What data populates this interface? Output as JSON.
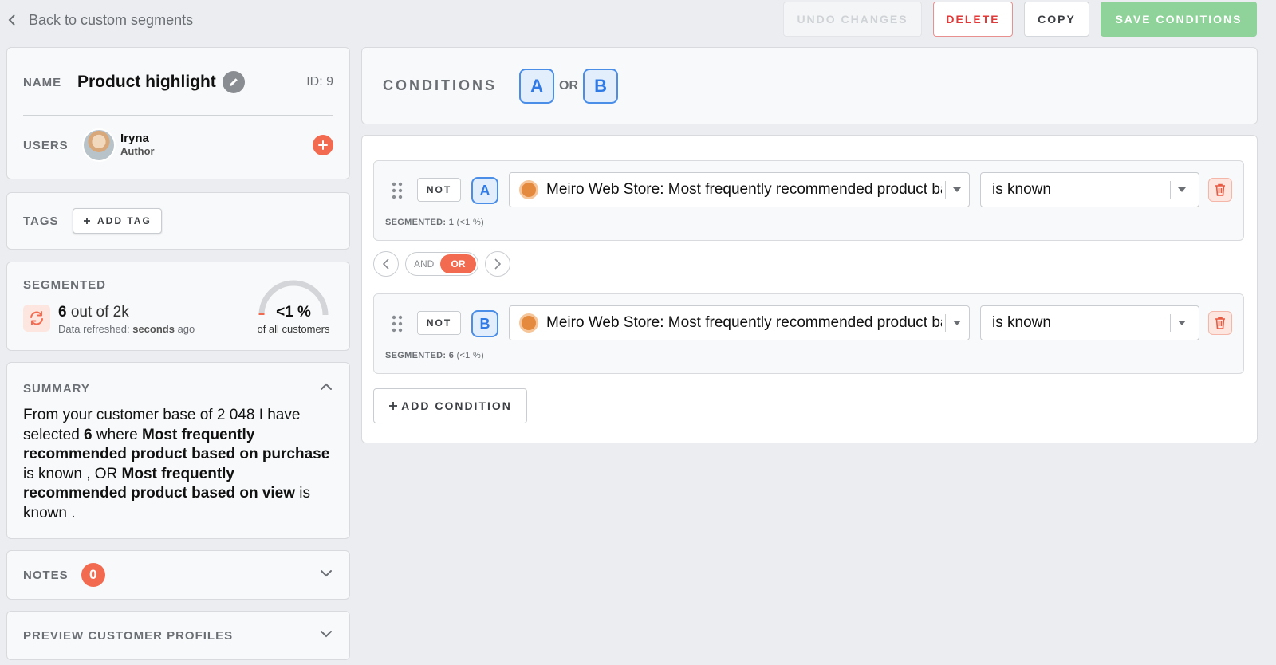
{
  "nav": {
    "back_label": "Back to custom segments"
  },
  "actions": {
    "undo": "UNDO CHANGES",
    "delete": "DELETE",
    "copy": "COPY",
    "save": "SAVE CONDITIONS"
  },
  "segment": {
    "name_label": "NAME",
    "name": "Product highlight",
    "id": "ID: 9",
    "users_label": "USERS",
    "user": {
      "name": "Iryna",
      "role": "Author"
    },
    "tags_label": "TAGS",
    "add_tag": "ADD TAG"
  },
  "segmented": {
    "label": "SEGMENTED",
    "count": "6",
    "out_of": " out of 2k",
    "refresh_prefix": "Data refreshed: ",
    "refresh_time": "seconds",
    "refresh_suffix": " ago",
    "percent": "<1 %",
    "percent_sub": "of all customers",
    "gauge_fraction": 0.003
  },
  "summary": {
    "label": "SUMMARY",
    "p1": "From your customer base of 2 048 I have selected ",
    "count": "6",
    "p2": " where ",
    "attr1": "Most frequently recommended product based on purchase",
    "p3": " is known , OR ",
    "attr2": "Most frequently recommended product based on view",
    "p4": " is known ."
  },
  "notes": {
    "label": "NOTES",
    "count": "0"
  },
  "preview": {
    "label": "PREVIEW CUSTOMER PROFILES"
  },
  "conditions": {
    "title": "CONDITIONS",
    "expr_a": "A",
    "expr_or": "OR",
    "expr_b": "B",
    "rows": [
      {
        "not": "NOT",
        "letter": "A",
        "attribute": "Meiro Web Store: Most frequently recommended product based on purchase",
        "operator": "is known",
        "seg_label": "SEGMENTED: 1",
        "seg_pct": "(<1 %)"
      },
      {
        "not": "NOT",
        "letter": "B",
        "attribute": "Meiro Web Store: Most frequently recommended product based on view",
        "operator": "is known",
        "seg_label": "SEGMENTED: 6",
        "seg_pct": "(<1 %)"
      }
    ],
    "toggle_and": "AND",
    "toggle_or": "OR",
    "add_condition": "ADD CONDITION"
  },
  "colors": {
    "accent_orange": "#f26b50",
    "accent_blue": "#2f7ae5",
    "save_green": "#8fd29a",
    "delete_red": "#e03a3a"
  },
  "icons": [
    "chevron-left-icon",
    "pencil-icon",
    "plus-icon",
    "refresh-icon",
    "chevron-up-icon",
    "chevron-down-icon",
    "drag-handle-icon",
    "caret-down-icon",
    "trash-icon",
    "arrow-left-icon",
    "arrow-right-icon",
    "source-icon"
  ]
}
